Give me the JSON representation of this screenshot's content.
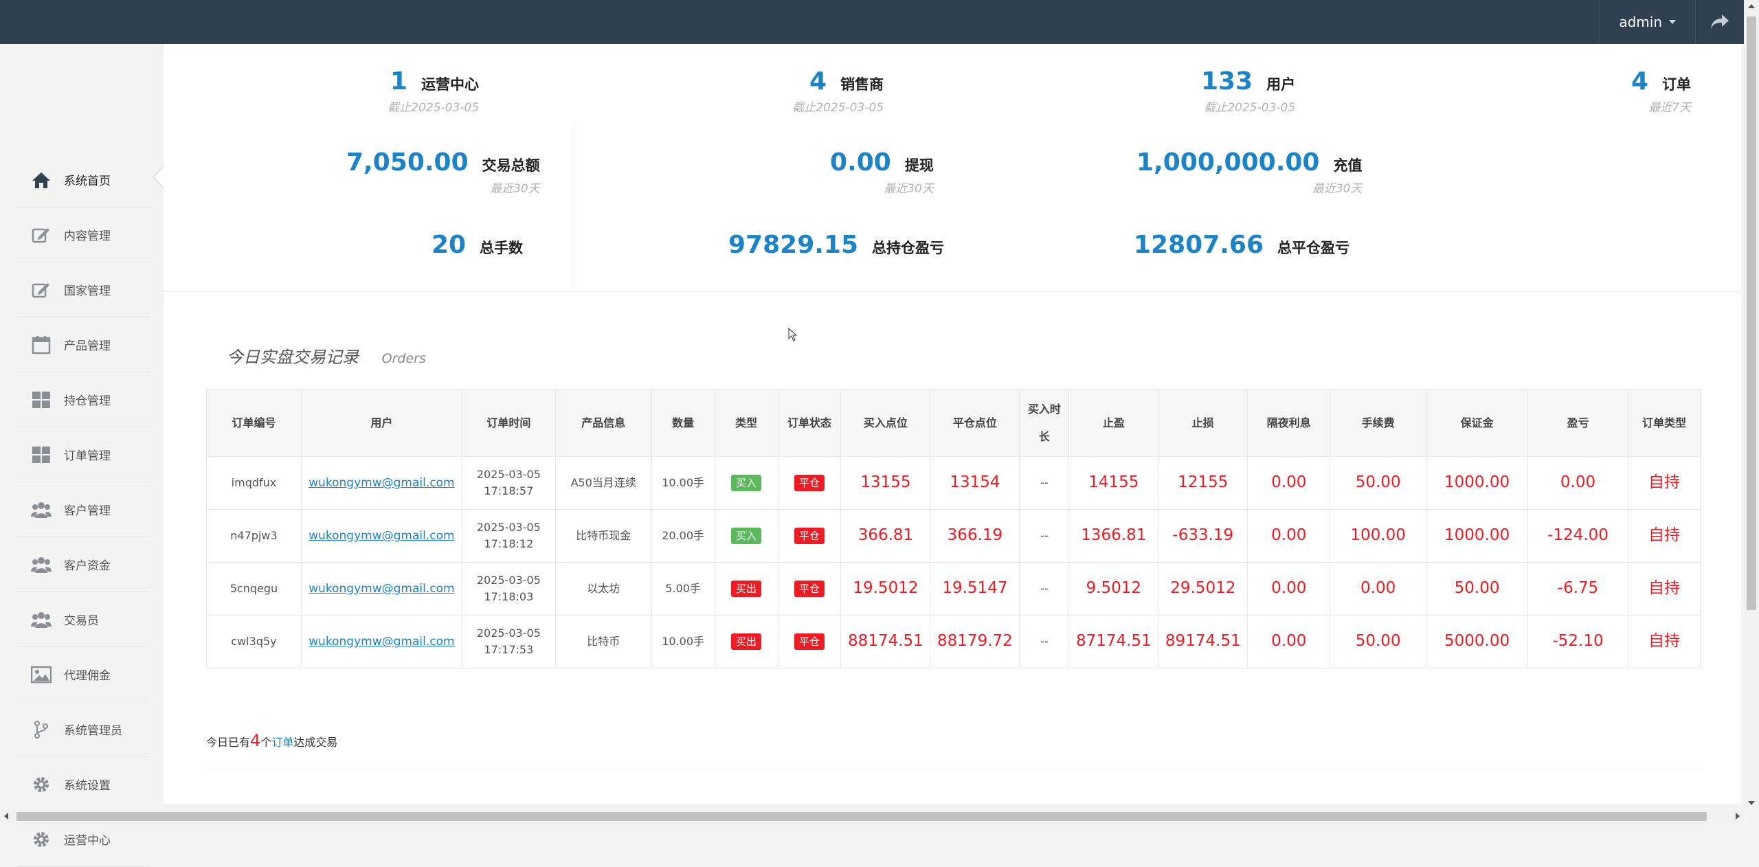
{
  "topbar": {
    "user": "admin"
  },
  "sidebar": {
    "items": [
      {
        "label": "系统首页",
        "icon": "home-icon"
      },
      {
        "label": "内容管理",
        "icon": "edit-icon"
      },
      {
        "label": "国家管理",
        "icon": "edit-icon"
      },
      {
        "label": "产品管理",
        "icon": "calendar-icon"
      },
      {
        "label": "持仓管理",
        "icon": "grid-icon"
      },
      {
        "label": "订单管理",
        "icon": "grid-icon"
      },
      {
        "label": "客户管理",
        "icon": "users-icon"
      },
      {
        "label": "客户资金",
        "icon": "users-icon"
      },
      {
        "label": "交易员",
        "icon": "users-icon"
      },
      {
        "label": "代理佣金",
        "icon": "image-icon"
      },
      {
        "label": "系统管理员",
        "icon": "branch-icon"
      },
      {
        "label": "系统设置",
        "icon": "gear-icon"
      },
      {
        "label": "运营中心",
        "icon": "gear-icon"
      }
    ]
  },
  "stats": {
    "ops_center": {
      "value": "1",
      "label": "运营中心",
      "sub": "截止2025-03-05"
    },
    "sellers": {
      "value": "4",
      "label": "销售商",
      "sub": "截止2025-03-05"
    },
    "users": {
      "value": "133",
      "label": "用户",
      "sub": "截止2025-03-05"
    },
    "orders": {
      "value": "4",
      "label": "订单",
      "sub": "最近7天"
    },
    "total_trade": {
      "value": "7,050.00",
      "label": "交易总额",
      "sub": "最近30天"
    },
    "withdraw": {
      "value": "0.00",
      "label": "提现",
      "sub": "最近30天"
    },
    "recharge": {
      "value": "1,000,000.00",
      "label": "充值",
      "sub": "最近30天"
    },
    "total_lots": {
      "value": "20",
      "label": "总手数"
    },
    "holding_pl": {
      "value": "97829.15",
      "label": "总持仓盈亏"
    },
    "closed_pl": {
      "value": "12807.66",
      "label": "总平仓盈亏"
    }
  },
  "orders_section": {
    "title": "今日实盘交易记录",
    "title_en": "Orders",
    "headers": [
      "订单编号",
      "用户",
      "订单时间",
      "产品信息",
      "数量",
      "类型",
      "订单状态",
      "买入点位",
      "平仓点位",
      "买入时长",
      "止盈",
      "止损",
      "隔夜利息",
      "手续费",
      "保证金",
      "盈亏",
      "订单类型"
    ],
    "rows": [
      {
        "id": "imqdfux",
        "user": "wukongymw@gmail.com",
        "date": "2025-03-05",
        "time": "17:18:57",
        "product": "A50当月连续",
        "qty": "10.00手",
        "type": "买入",
        "status": "平仓",
        "buy": "13155",
        "close": "13154",
        "duration": "--",
        "tp": "14155",
        "sl": "12155",
        "overnight": "0.00",
        "fee": "50.00",
        "margin": "1000.00",
        "pl": "0.00",
        "order_type": "自持"
      },
      {
        "id": "n47pjw3",
        "user": "wukongymw@gmail.com",
        "date": "2025-03-05",
        "time": "17:18:12",
        "product": "比特币现金",
        "qty": "20.00手",
        "type": "买入",
        "status": "平仓",
        "buy": "366.81",
        "close": "366.19",
        "duration": "--",
        "tp": "1366.81",
        "sl": "-633.19",
        "overnight": "0.00",
        "fee": "100.00",
        "margin": "1000.00",
        "pl": "-124.00",
        "order_type": "自持"
      },
      {
        "id": "5cnqegu",
        "user": "wukongymw@gmail.com",
        "date": "2025-03-05",
        "time": "17:18:03",
        "product": "以太坊",
        "qty": "5.00手",
        "type": "买出",
        "status": "平仓",
        "buy": "19.5012",
        "close": "19.5147",
        "duration": "--",
        "tp": "9.5012",
        "sl": "29.5012",
        "overnight": "0.00",
        "fee": "0.00",
        "margin": "50.00",
        "pl": "-6.75",
        "order_type": "自持"
      },
      {
        "id": "cwl3q5y",
        "user": "wukongymw@gmail.com",
        "date": "2025-03-05",
        "time": "17:17:53",
        "product": "比特币",
        "qty": "10.00手",
        "type": "买出",
        "status": "平仓",
        "buy": "88174.51",
        "close": "88179.72",
        "duration": "--",
        "tp": "87174.51",
        "sl": "89174.51",
        "overnight": "0.00",
        "fee": "50.00",
        "margin": "5000.00",
        "pl": "-52.10",
        "order_type": "自持"
      }
    ],
    "summary_prefix": "今日已有",
    "summary_count": "4",
    "summary_mid": "个",
    "summary_link": "订单",
    "summary_suffix": "达成交易"
  },
  "colors": {
    "topbar": "#2f4050",
    "accent": "#1c84c6",
    "red": "#ed1c24",
    "buy": "#5cb85c"
  }
}
